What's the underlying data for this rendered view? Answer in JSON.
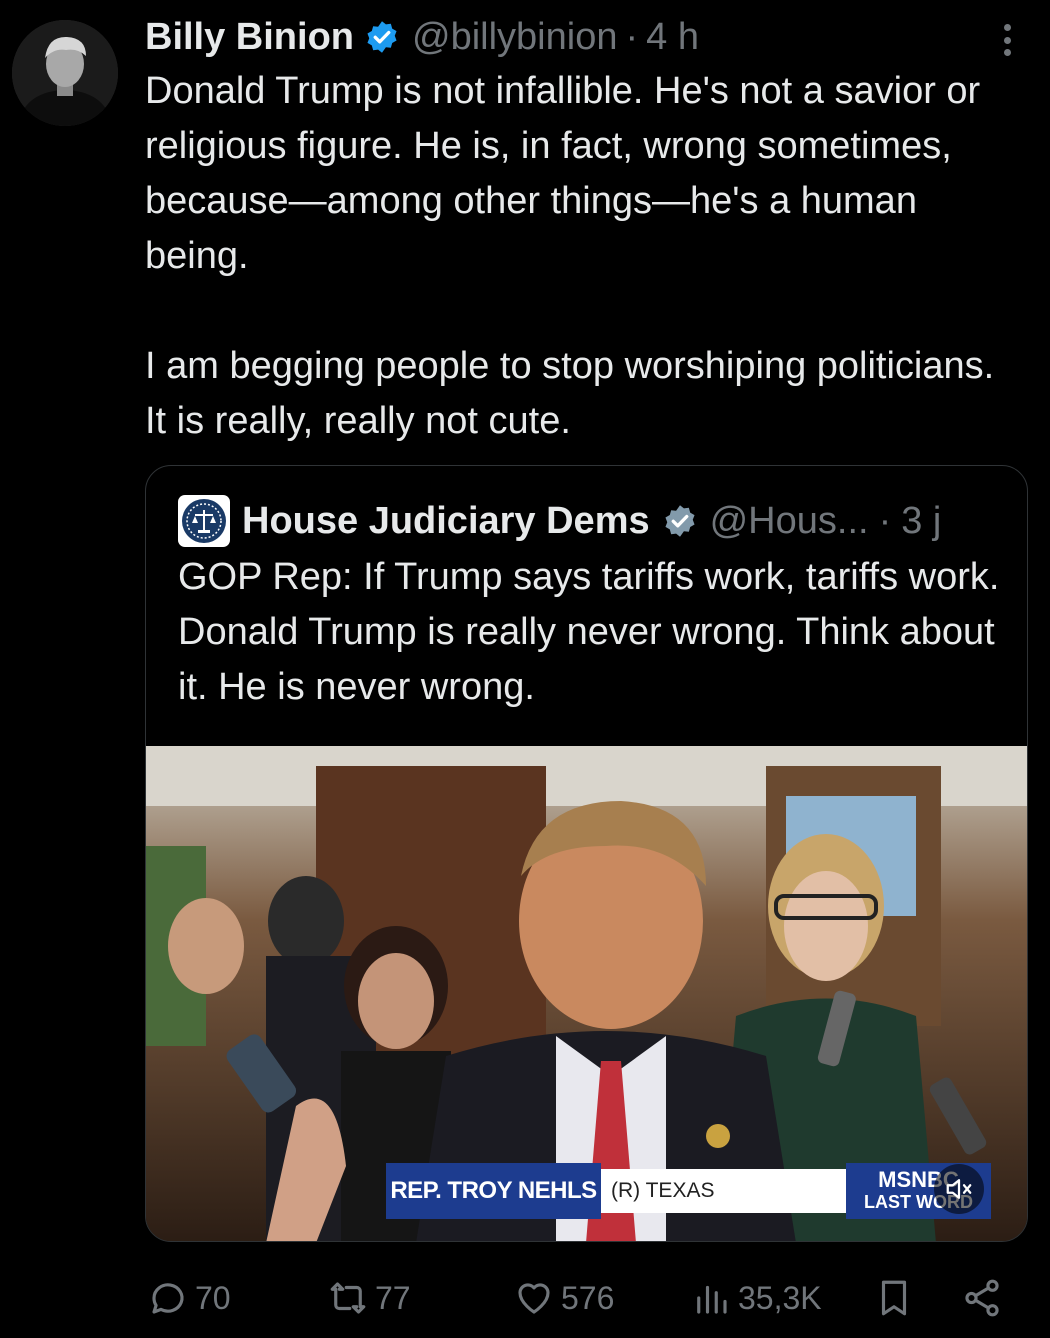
{
  "tweet": {
    "author_name": "Billy Binion",
    "author_handle": "@billybinion",
    "separator": "·",
    "time": "4 h",
    "paragraph_1": "Donald Trump is not infallible. He's not a savior or religious figure. He is, in fact, wrong sometimes, because—among other things—he's a human being.",
    "paragraph_2": "I am begging people to stop worshiping politicians. It is really, really not cute."
  },
  "quote": {
    "author_name": "House Judiciary Dems",
    "author_handle": "@Hous...",
    "separator": "·",
    "time": "3 j",
    "text": "GOP Rep: If Trump says tariffs work, tariffs work. Donald Trump is really never wrong. Think about it. He is never wrong.",
    "video": {
      "chyron_name": "REP. TROY NEHLS",
      "chyron_state": "(R) TEXAS",
      "network_line_1": "MSNBC",
      "network_line_2": "LAST WORD",
      "muted": true
    }
  },
  "actions": {
    "replies": "70",
    "reposts": "77",
    "likes": "576",
    "views": "35,3K"
  },
  "colors": {
    "background": "#000000",
    "text": "#e7e9ea",
    "secondary": "#71767b",
    "verified": "#1d9bf0",
    "border": "#2f3336"
  },
  "icons": [
    "verified-badge-icon",
    "more-options-icon",
    "reply-icon",
    "repost-icon",
    "like-icon",
    "views-icon",
    "bookmark-icon",
    "share-icon",
    "mute-icon"
  ]
}
